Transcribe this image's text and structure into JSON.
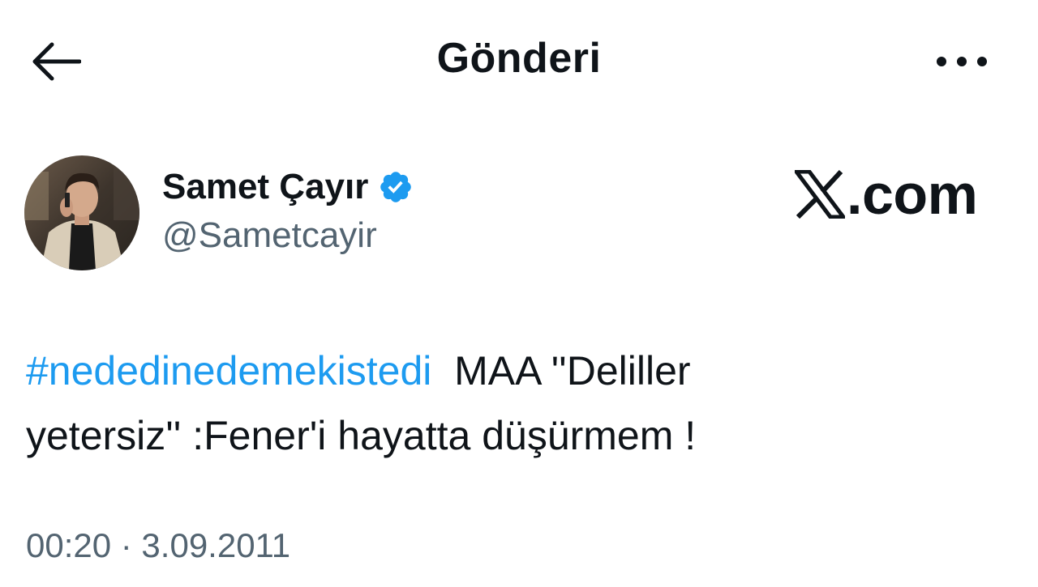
{
  "header": {
    "title": "Gönderi",
    "back_icon": "arrow-left-icon",
    "more_icon": "more-horizontal-icon"
  },
  "author": {
    "name": "Samet Çayır",
    "handle": "@Sametcayir",
    "verified_icon": "verified-badge-icon",
    "verified_color": "#1d9bf0"
  },
  "brand": {
    "text": ".com",
    "logo_icon": "x-logo-icon"
  },
  "tweet": {
    "hashtag": "#nededinedemekistedi",
    "text_line1": "  MAA ''Deliller",
    "text_line2": "yetersiz'' :Fener'i hayatta düşürmem !"
  },
  "meta": {
    "timestamp": "00:20 · 3.09.2011"
  },
  "colors": {
    "accent": "#1d9bf0",
    "text": "#0f1419",
    "secondary": "#536471"
  }
}
